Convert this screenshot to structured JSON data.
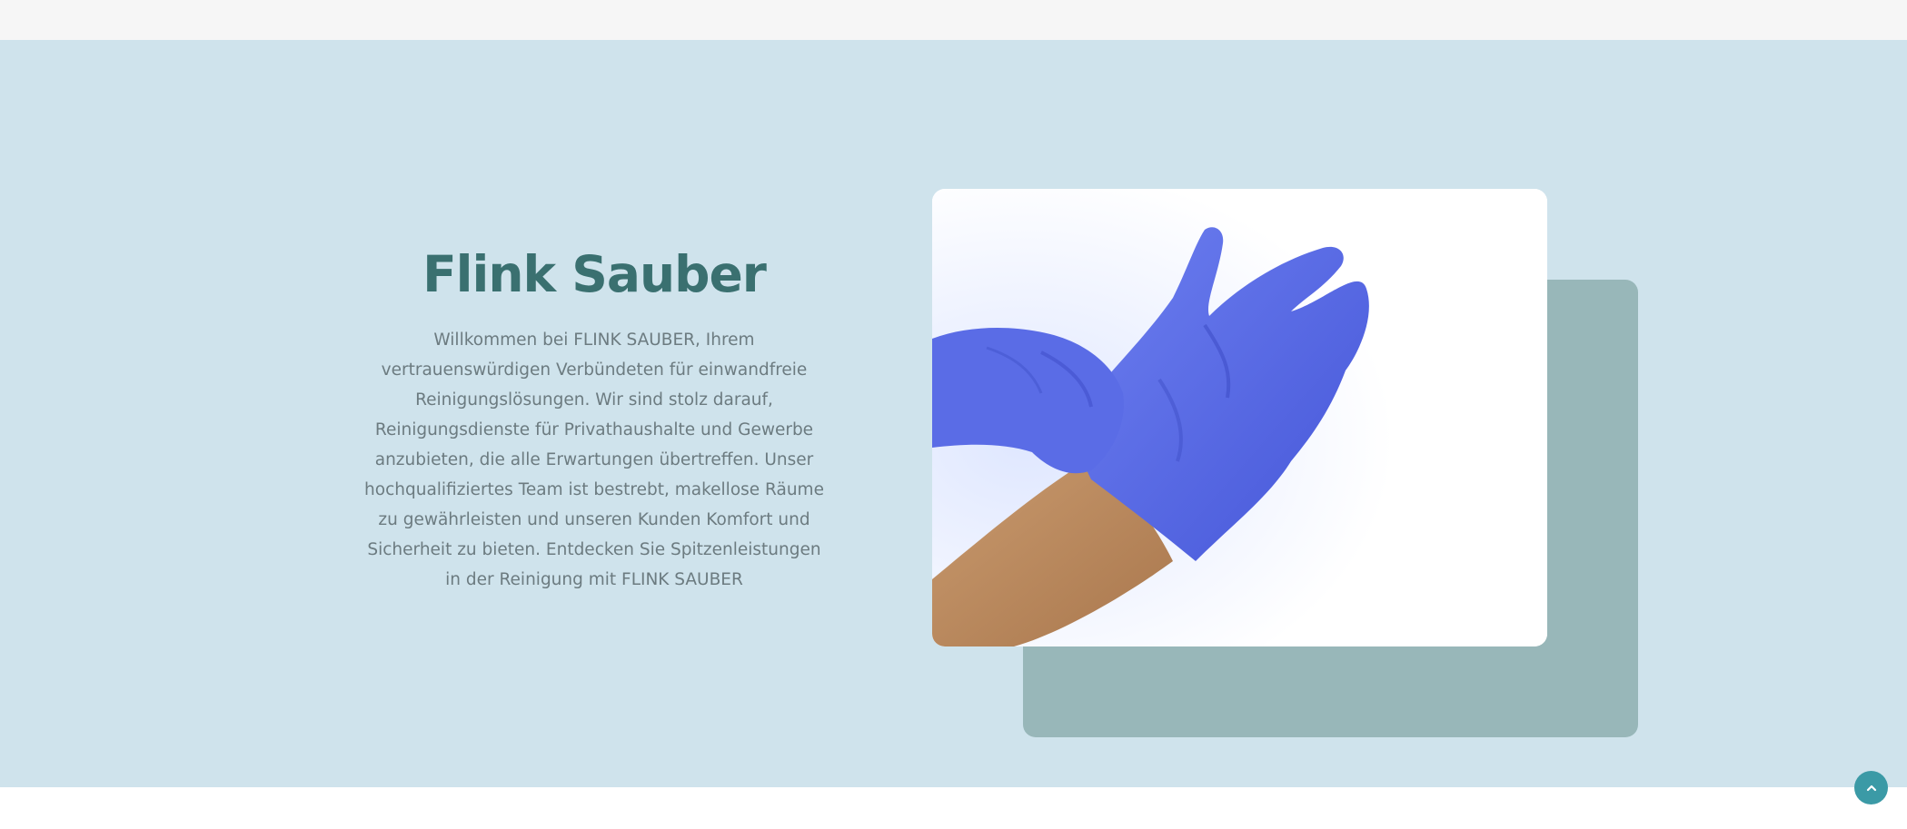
{
  "hero": {
    "title": "Flink Sauber",
    "description": "Willkommen bei FLINK SAUBER, Ihrem vertrauenswürdigen Verbündeten für einwandfreie Reinigungslösungen. Wir sind stolz darauf, Reinigungsdienste für Privathaushalte und Gewerbe anzubieten, die alle Erwartungen übertreffen. Unser hochqualifiziertes Team ist bestrebt, makellose Räume zu gewährleisten und unseren Kunden Komfort und Sicherheit zu bieten. Entdecken Sie Spitzenleistungen in der Reinigung mit FLINK SAUBER",
    "image_icon": "blue-gloves-photo"
  },
  "scroll_top": {
    "icon": "chevron-up-icon"
  },
  "colors": {
    "hero_background": "#cfe3ec",
    "title": "#3a7070",
    "body_text": "#6c7b80",
    "back_card": "#98b7b9",
    "scroll_button": "#3b9aa6",
    "glove": "#5b6ee8"
  }
}
